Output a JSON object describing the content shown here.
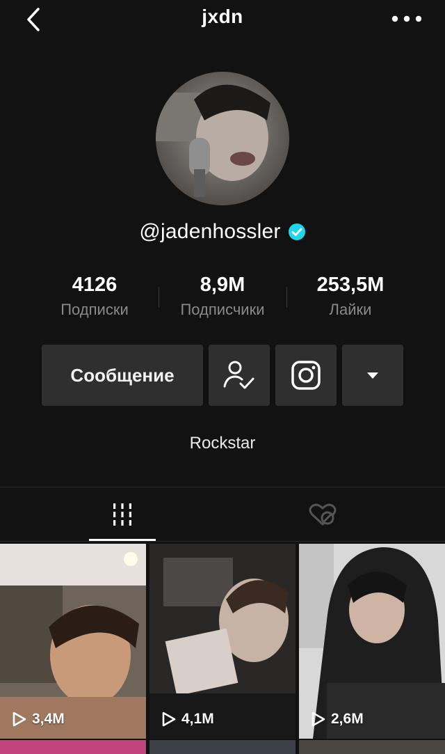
{
  "header": {
    "title": "jxdn"
  },
  "profile": {
    "username": "@jadenhossler",
    "verified": true,
    "bio": "Rockstar"
  },
  "stats": [
    {
      "value": "4126",
      "label": "Подписки"
    },
    {
      "value": "8,9M",
      "label": "Подписчики"
    },
    {
      "value": "253,5M",
      "label": "Лайки"
    }
  ],
  "actions": {
    "message_label": "Сообщение"
  },
  "videos": [
    {
      "views": "3,4M"
    },
    {
      "views": "4,1M"
    },
    {
      "views": "2,6M"
    }
  ],
  "icons": {
    "back": "chevron-left-icon",
    "more": "more-horizontal-icon",
    "verified": "verified-badge-icon",
    "following": "user-check-icon",
    "instagram": "instagram-icon",
    "dropdown": "caret-down-icon",
    "videos_tab": "grid-icon",
    "liked_tab": "hidden-heart-icon",
    "play": "play-icon"
  },
  "colors": {
    "background": "#121212",
    "button": "#2f2f2f",
    "muted": "#8a8a8a",
    "verified": "#20d5ec"
  }
}
